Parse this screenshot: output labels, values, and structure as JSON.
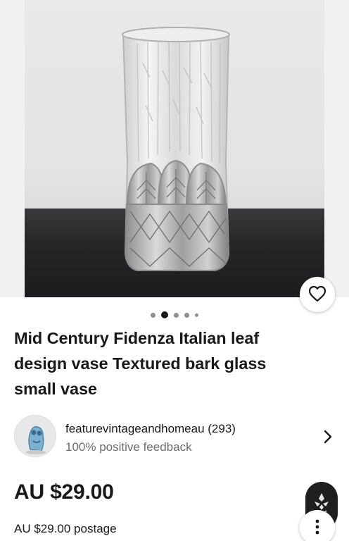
{
  "listing": {
    "title": "Mid Century Fidenza Italian leaf design vase Textured bark glass small vase",
    "image_alt": "Clear textured glass vase with leaf design",
    "gallery": {
      "count": 5,
      "active_index": 1
    },
    "price": "AU $29.00",
    "postage": "AU $29.00 postage"
  },
  "seller": {
    "name": "featurevintageandhomeau (293)",
    "feedback": "100% positive feedback"
  },
  "icons": {
    "favorite": "heart-outline-icon",
    "seller_chevron": "chevron-right-icon",
    "more": "more-vertical-icon",
    "brand": "brand-badge-icon"
  },
  "colors": {
    "text": "#191919",
    "muted": "#6b6b6b",
    "badge_bg": "#1f1f1f"
  }
}
